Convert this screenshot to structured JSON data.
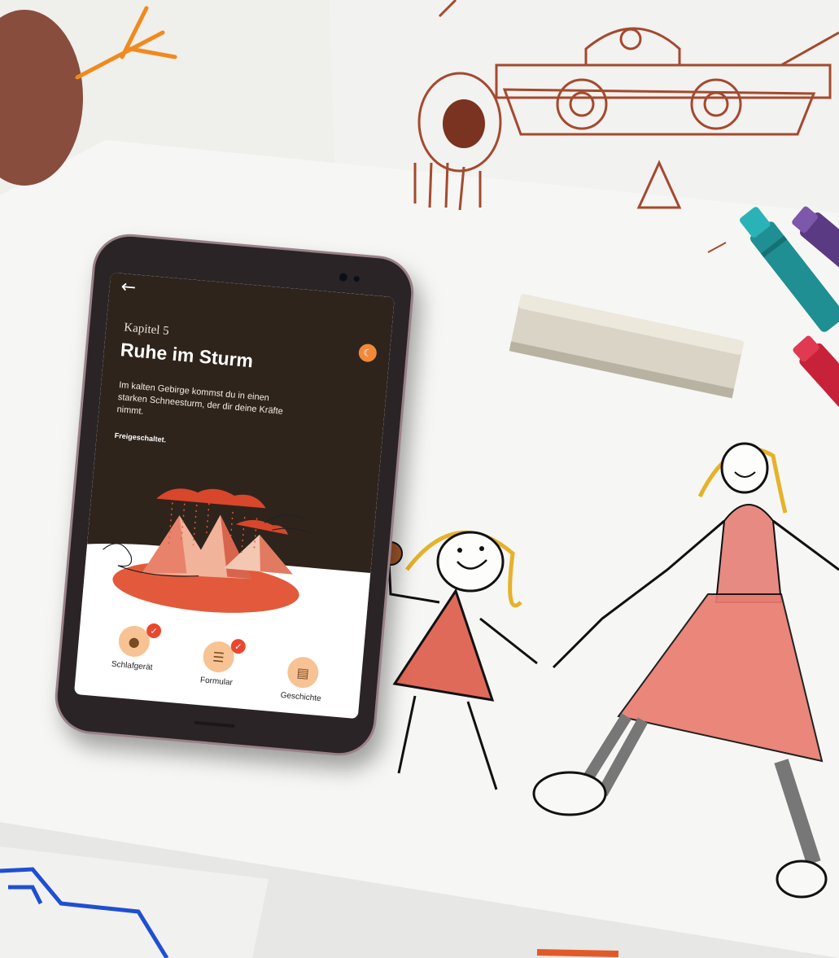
{
  "screen": {
    "chapter": "Kapitel 5",
    "title": "Ruhe im Sturm",
    "description": "Im kalten Gebirge kommst du in einen starken Schneesturm, der dir deine Kräfte nimmt.",
    "status": "Freigeschaltet."
  },
  "icons": {
    "back": "arrow-left-icon",
    "mode": "moon-icon"
  },
  "nav": [
    {
      "label": "Schlafgerät",
      "icon": "sleep-device-icon",
      "checked": true
    },
    {
      "label": "Formular",
      "icon": "form-icon",
      "checked": true
    },
    {
      "label": "Geschichte",
      "icon": "story-icon",
      "checked": false
    }
  ],
  "colors": {
    "dark_background": "#2e241c",
    "accent_orange": "#f0893a",
    "icon_circle": "#f7c394",
    "check_badge": "#e9482f",
    "illustration_red": "#e25a3b"
  }
}
